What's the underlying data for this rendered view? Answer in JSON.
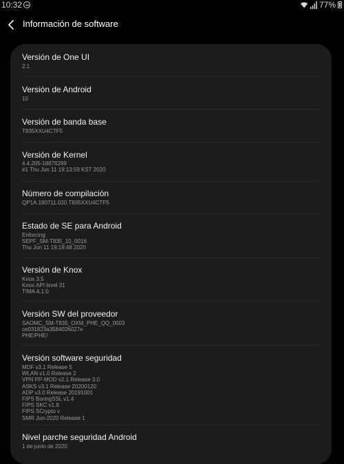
{
  "status_bar": {
    "time": "10:32",
    "battery": "77%"
  },
  "header": {
    "title": "Información de software"
  },
  "items": [
    {
      "label": "Versión de One UI",
      "value": "2.1"
    },
    {
      "label": "Versión de Android",
      "value": "10"
    },
    {
      "label": "Versión de banda base",
      "value": "T835XXU4CTF5"
    },
    {
      "label": "Versión de Kernel",
      "value": "4.4.205-18876299\n#1 Thu Jun 11 19:13:59 KST 2020"
    },
    {
      "label": "Número de compilación",
      "value": "QP1A.190711.020.T835XXU4CTF5"
    },
    {
      "label": "Estado de SE para Android",
      "value": "Enforcing\nSEPF_SM-T835_10_0016\nThu Jun 11 19:19:48 2020"
    },
    {
      "label": "Versión de Knox",
      "value": "Knox 3.5\nKnox API level 31\nTIMA 4.1.0"
    },
    {
      "label": "Versión SW del proveedor",
      "value": "SAOMC_SM-T835_OXM_PHE_QQ_0003\nce031823a3584026027e\nPHE/PHE/"
    },
    {
      "label": "Versión software seguridad",
      "value": "MDF v3.1 Release 5\nWLAN v1.0 Release 2\nVPN PP-MOD v2.1 Release 3.0\nASKS v3.1 Release 20200120\nADP v3.0 Release 20191001\nFIPS BoringSSL v1.4\nFIPS SKC v1.8\nFIPS SCrypto v\nSMR Jun-2020 Release 1"
    },
    {
      "label": "Nivel parche seguridad Android",
      "value": "1 de junio de 2020"
    }
  ]
}
